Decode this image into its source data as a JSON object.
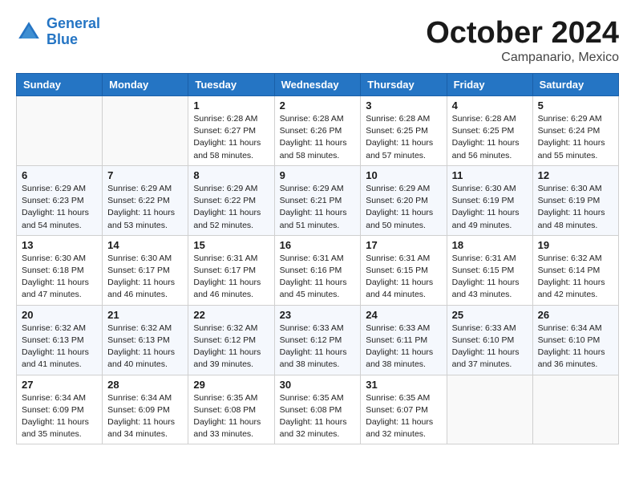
{
  "header": {
    "logo_line1": "General",
    "logo_line2": "Blue",
    "month": "October 2024",
    "location": "Campanario, Mexico"
  },
  "days_of_week": [
    "Sunday",
    "Monday",
    "Tuesday",
    "Wednesday",
    "Thursday",
    "Friday",
    "Saturday"
  ],
  "weeks": [
    [
      {
        "num": "",
        "info": ""
      },
      {
        "num": "",
        "info": ""
      },
      {
        "num": "1",
        "info": "Sunrise: 6:28 AM\nSunset: 6:27 PM\nDaylight: 11 hours and 58 minutes."
      },
      {
        "num": "2",
        "info": "Sunrise: 6:28 AM\nSunset: 6:26 PM\nDaylight: 11 hours and 58 minutes."
      },
      {
        "num": "3",
        "info": "Sunrise: 6:28 AM\nSunset: 6:25 PM\nDaylight: 11 hours and 57 minutes."
      },
      {
        "num": "4",
        "info": "Sunrise: 6:28 AM\nSunset: 6:25 PM\nDaylight: 11 hours and 56 minutes."
      },
      {
        "num": "5",
        "info": "Sunrise: 6:29 AM\nSunset: 6:24 PM\nDaylight: 11 hours and 55 minutes."
      }
    ],
    [
      {
        "num": "6",
        "info": "Sunrise: 6:29 AM\nSunset: 6:23 PM\nDaylight: 11 hours and 54 minutes."
      },
      {
        "num": "7",
        "info": "Sunrise: 6:29 AM\nSunset: 6:22 PM\nDaylight: 11 hours and 53 minutes."
      },
      {
        "num": "8",
        "info": "Sunrise: 6:29 AM\nSunset: 6:22 PM\nDaylight: 11 hours and 52 minutes."
      },
      {
        "num": "9",
        "info": "Sunrise: 6:29 AM\nSunset: 6:21 PM\nDaylight: 11 hours and 51 minutes."
      },
      {
        "num": "10",
        "info": "Sunrise: 6:29 AM\nSunset: 6:20 PM\nDaylight: 11 hours and 50 minutes."
      },
      {
        "num": "11",
        "info": "Sunrise: 6:30 AM\nSunset: 6:19 PM\nDaylight: 11 hours and 49 minutes."
      },
      {
        "num": "12",
        "info": "Sunrise: 6:30 AM\nSunset: 6:19 PM\nDaylight: 11 hours and 48 minutes."
      }
    ],
    [
      {
        "num": "13",
        "info": "Sunrise: 6:30 AM\nSunset: 6:18 PM\nDaylight: 11 hours and 47 minutes."
      },
      {
        "num": "14",
        "info": "Sunrise: 6:30 AM\nSunset: 6:17 PM\nDaylight: 11 hours and 46 minutes."
      },
      {
        "num": "15",
        "info": "Sunrise: 6:31 AM\nSunset: 6:17 PM\nDaylight: 11 hours and 46 minutes."
      },
      {
        "num": "16",
        "info": "Sunrise: 6:31 AM\nSunset: 6:16 PM\nDaylight: 11 hours and 45 minutes."
      },
      {
        "num": "17",
        "info": "Sunrise: 6:31 AM\nSunset: 6:15 PM\nDaylight: 11 hours and 44 minutes."
      },
      {
        "num": "18",
        "info": "Sunrise: 6:31 AM\nSunset: 6:15 PM\nDaylight: 11 hours and 43 minutes."
      },
      {
        "num": "19",
        "info": "Sunrise: 6:32 AM\nSunset: 6:14 PM\nDaylight: 11 hours and 42 minutes."
      }
    ],
    [
      {
        "num": "20",
        "info": "Sunrise: 6:32 AM\nSunset: 6:13 PM\nDaylight: 11 hours and 41 minutes."
      },
      {
        "num": "21",
        "info": "Sunrise: 6:32 AM\nSunset: 6:13 PM\nDaylight: 11 hours and 40 minutes."
      },
      {
        "num": "22",
        "info": "Sunrise: 6:32 AM\nSunset: 6:12 PM\nDaylight: 11 hours and 39 minutes."
      },
      {
        "num": "23",
        "info": "Sunrise: 6:33 AM\nSunset: 6:12 PM\nDaylight: 11 hours and 38 minutes."
      },
      {
        "num": "24",
        "info": "Sunrise: 6:33 AM\nSunset: 6:11 PM\nDaylight: 11 hours and 38 minutes."
      },
      {
        "num": "25",
        "info": "Sunrise: 6:33 AM\nSunset: 6:10 PM\nDaylight: 11 hours and 37 minutes."
      },
      {
        "num": "26",
        "info": "Sunrise: 6:34 AM\nSunset: 6:10 PM\nDaylight: 11 hours and 36 minutes."
      }
    ],
    [
      {
        "num": "27",
        "info": "Sunrise: 6:34 AM\nSunset: 6:09 PM\nDaylight: 11 hours and 35 minutes."
      },
      {
        "num": "28",
        "info": "Sunrise: 6:34 AM\nSunset: 6:09 PM\nDaylight: 11 hours and 34 minutes."
      },
      {
        "num": "29",
        "info": "Sunrise: 6:35 AM\nSunset: 6:08 PM\nDaylight: 11 hours and 33 minutes."
      },
      {
        "num": "30",
        "info": "Sunrise: 6:35 AM\nSunset: 6:08 PM\nDaylight: 11 hours and 32 minutes."
      },
      {
        "num": "31",
        "info": "Sunrise: 6:35 AM\nSunset: 6:07 PM\nDaylight: 11 hours and 32 minutes."
      },
      {
        "num": "",
        "info": ""
      },
      {
        "num": "",
        "info": ""
      }
    ]
  ]
}
